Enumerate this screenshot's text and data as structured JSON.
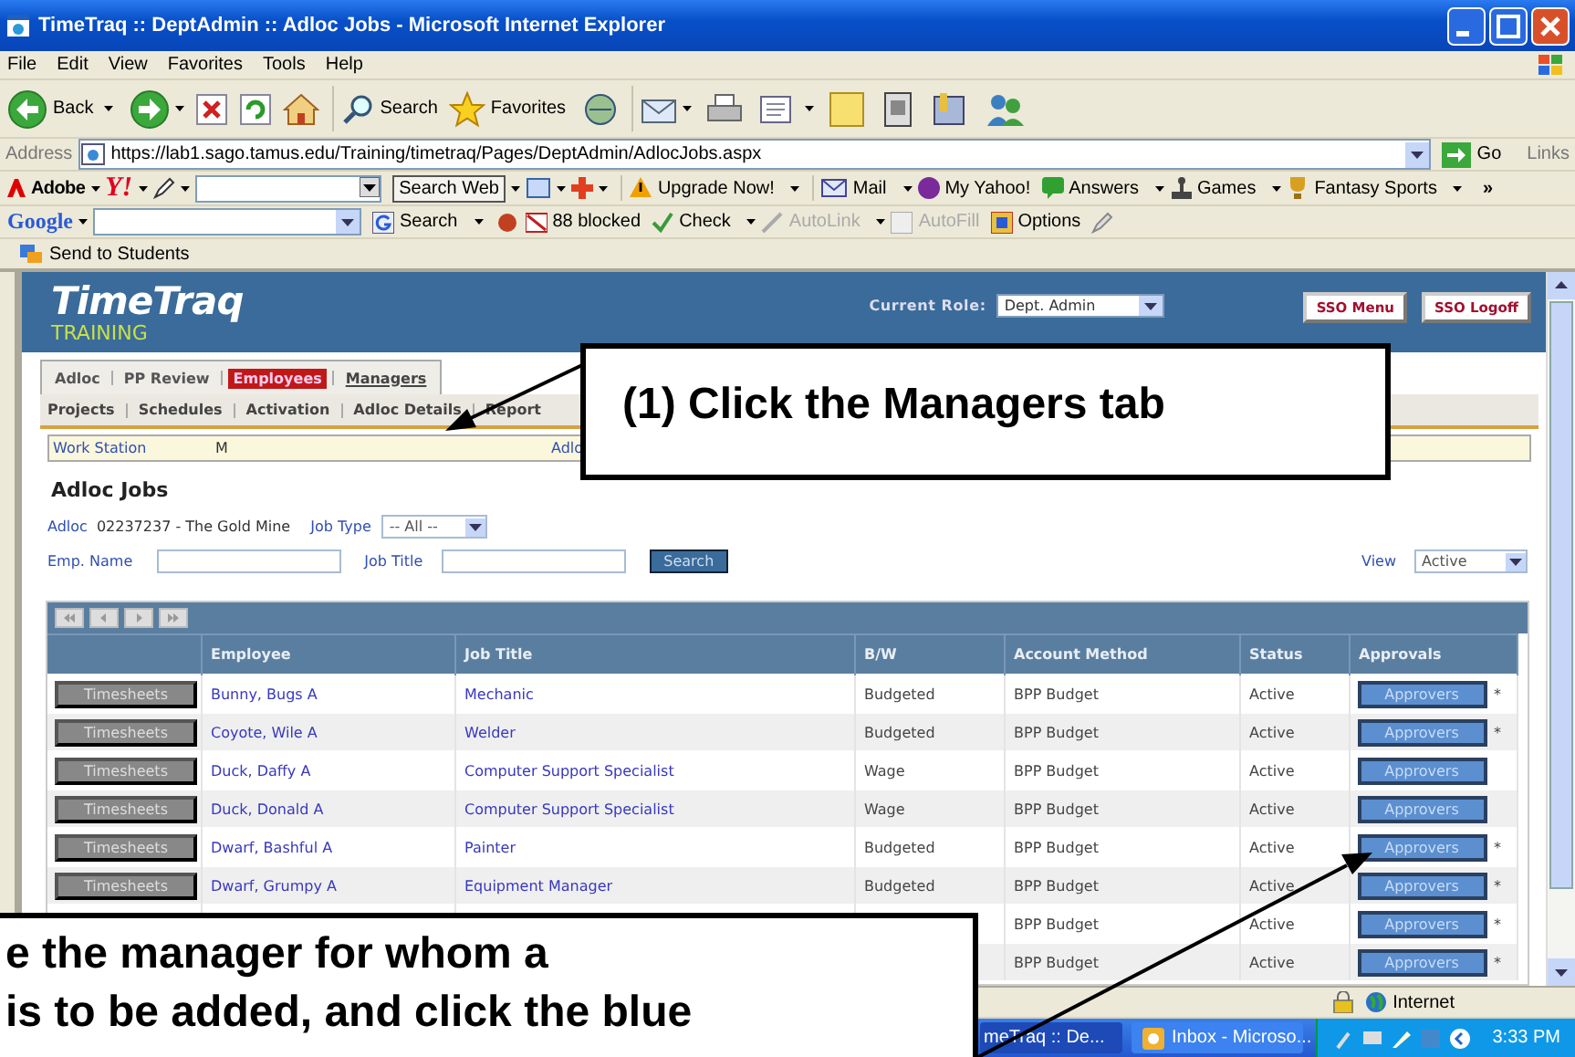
{
  "window": {
    "title": "TimeTraq :: DeptAdmin :: Adloc Jobs - Microsoft Internet Explorer"
  },
  "menu": [
    "File",
    "Edit",
    "View",
    "Favorites",
    "Tools",
    "Help"
  ],
  "toolbar": {
    "back": "Back",
    "search": "Search",
    "favorites": "Favorites"
  },
  "address_bar": {
    "label": "Address",
    "value": "https://lab1.sago.tamus.edu/Training/timetraq/Pages/DeptAdmin/AdlocJobs.aspx",
    "go": "Go",
    "links": "Links"
  },
  "yahoo_toolbar": {
    "adobe": "Adobe",
    "yahoo": "Y!",
    "search_button": "Search Web",
    "items": [
      "Upgrade Now!",
      "Mail",
      "My Yahoo!",
      "Answers",
      "Games",
      "Fantasy Sports"
    ],
    "more": "»"
  },
  "google_toolbar": {
    "logo": "Google",
    "items": [
      {
        "label": "Search",
        "disabled": false
      },
      {
        "label": "88 blocked",
        "disabled": false
      },
      {
        "label": "Check",
        "disabled": false
      },
      {
        "label": "AutoLink",
        "disabled": true
      },
      {
        "label": "AutoFill",
        "disabled": true
      },
      {
        "label": "Options",
        "disabled": false
      }
    ]
  },
  "links_bar": {
    "items": [
      "Send to Students"
    ]
  },
  "app": {
    "logo": "TimeTraq",
    "edition": "TRAINING",
    "role_label": "Current Role:",
    "role": "Dept. Admin",
    "header_buttons": [
      "SSO Menu",
      "SSO Logoff"
    ],
    "tabs": [
      {
        "label": "Adloc",
        "selected": false
      },
      {
        "label": "PP Review",
        "selected": false
      },
      {
        "label": "Employees",
        "selected": true
      },
      {
        "label": "Managers",
        "selected": false
      }
    ],
    "subtabs": [
      "Projects",
      "Schedules",
      "Activation",
      "Adloc Details",
      "Report"
    ],
    "info_bar": [
      "Work Station",
      "M",
      "Adlo"
    ],
    "heading": "Adloc Jobs",
    "filters": {
      "adloc_label": "Adloc",
      "adloc_value": "02237237 - The Gold Mine",
      "job_type_label": "Job Type",
      "job_type": "-- All --",
      "emp_name_label": "Emp. Name",
      "job_title_label": "Job Title",
      "search_button": "Search",
      "view_label": "View",
      "view": "Active"
    },
    "table": {
      "columns": [
        "Employee",
        "Job Title",
        "B/W",
        "Account Method",
        "Status",
        "Approvals"
      ],
      "rows": [
        {
          "button": "Timesheets",
          "employee": "Bunny, Bugs A",
          "job_title": "Mechanic",
          "bw": "Budgeted",
          "account_method": "BPP Budget",
          "status": "Active",
          "approvals": "Approvers",
          "note": "*"
        },
        {
          "button": "Timesheets",
          "employee": "Coyote, Wile A",
          "job_title": "Welder",
          "bw": "Budgeted",
          "account_method": "BPP Budget",
          "status": "Active",
          "approvals": "Approvers",
          "note": "*"
        },
        {
          "button": "Timesheets",
          "employee": "Duck, Daffy A",
          "job_title": "Computer Support Specialist",
          "bw": "Wage",
          "account_method": "BPP Budget",
          "status": "Active",
          "approvals": "Approvers"
        },
        {
          "button": "Timesheets",
          "employee": "Duck, Donald A",
          "job_title": "Computer Support Specialist",
          "bw": "Wage",
          "account_method": "BPP Budget",
          "status": "Active",
          "approvals": "Approvers"
        },
        {
          "button": "Timesheets",
          "employee": "Dwarf, Bashful A",
          "job_title": "Painter",
          "bw": "Budgeted",
          "account_method": "BPP Budget",
          "status": "Active",
          "approvals": "Approvers",
          "note": "*"
        },
        {
          "button": "Timesheets",
          "employee": "Dwarf, Grumpy A",
          "job_title": "Equipment Manager",
          "bw": "Budgeted",
          "account_method": "BPP Budget",
          "status": "Active",
          "approvals": "Approvers",
          "note": "*"
        },
        {
          "account_method": "BPP Budget",
          "status": "Active",
          "approvals": "Approvers",
          "note": "*"
        },
        {
          "account_method": "BPP Budget",
          "status": "Active",
          "approvals": "Approvers",
          "note": "*"
        }
      ]
    }
  },
  "status_bar": {
    "zone": "Internet"
  },
  "taskbar": {
    "tasks": [
      "meTraq :: De...",
      "Inbox - Microso..."
    ],
    "clock": "3:33 PM"
  },
  "callouts": [
    {
      "lines": [
        "(1) Click the Managers tab"
      ]
    },
    {
      "lines": [
        "e the manager for whom a",
        "is to be added, and click the blue"
      ]
    }
  ]
}
